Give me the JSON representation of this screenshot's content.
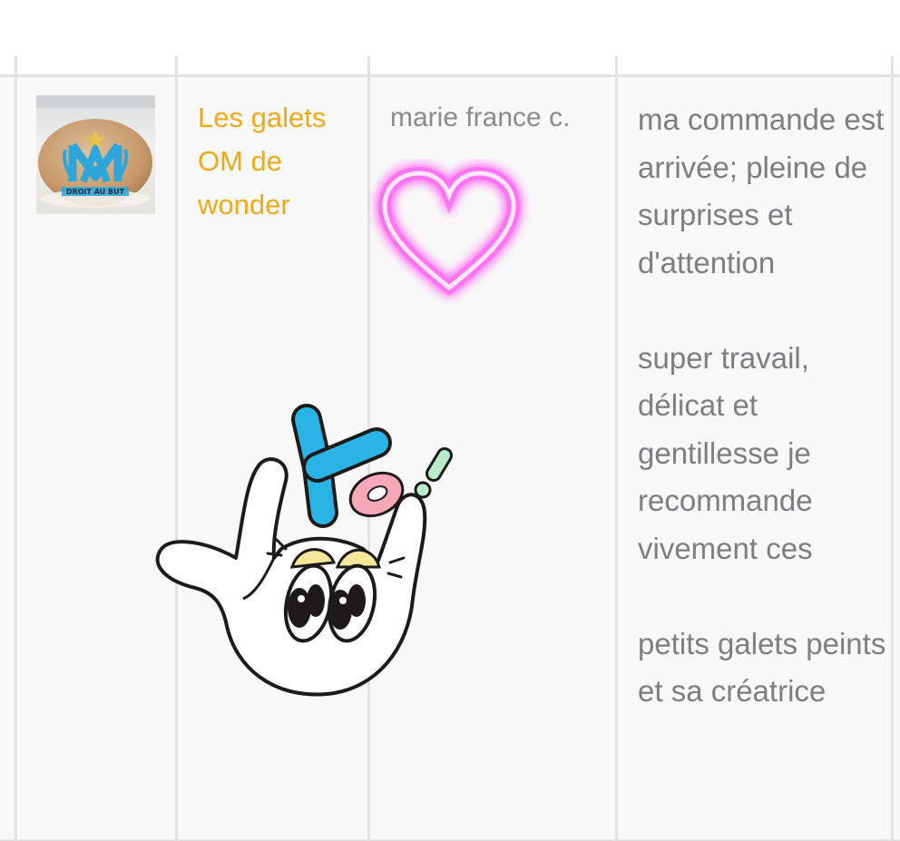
{
  "product": {
    "thumbnail_icon": "om-logo-painted-pebble-icon",
    "title": "Les galets OM de wonder"
  },
  "review": {
    "author": "marie france c.",
    "paragraph_1": "ma commande est arrivée; pleine de surprises et d'attention",
    "paragraph_2": "super travail, délicat et gentillesse je recommande vivement ces",
    "paragraph_3": "petits galets peints et sa créatrice"
  },
  "stickers": {
    "heart": "neon-heart-icon",
    "yo": "yo-hand-sticker-icon"
  },
  "colors": {
    "link": "#f0a916",
    "text": "#7d7d83",
    "row_bg": "#f8f8f8",
    "grid": "#e2e2e2",
    "neon": "#ff66ff",
    "yo_blue": "#2ab4e6"
  }
}
